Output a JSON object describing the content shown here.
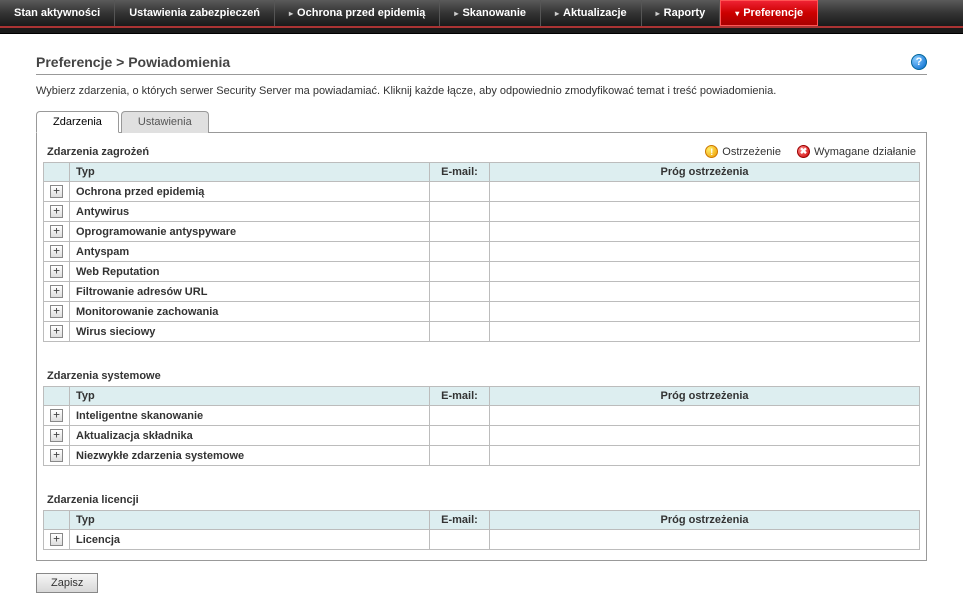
{
  "nav": {
    "items": [
      {
        "label": "Stan aktywności",
        "arrow": false
      },
      {
        "label": "Ustawienia zabezpieczeń",
        "arrow": false
      },
      {
        "label": "Ochrona przed epidemią",
        "arrow": true
      },
      {
        "label": "Skanowanie",
        "arrow": true
      },
      {
        "label": "Aktualizacje",
        "arrow": true
      },
      {
        "label": "Raporty",
        "arrow": true
      },
      {
        "label": "Preferencje",
        "arrow": true,
        "active": true
      }
    ]
  },
  "breadcrumb": "Preferencje > Powiadomienia",
  "help_tooltip": "?",
  "instruction": "Wybierz zdarzenia, o których serwer Security Server ma powiadamiać. Kliknij każde łącze, aby odpowiednio zmodyfikować temat i treść powiadomienia.",
  "tabs": [
    {
      "label": "Zdarzenia",
      "active": true
    },
    {
      "label": "Ustawienia",
      "active": false
    }
  ],
  "legend": {
    "warning": "Ostrzeżenie",
    "action_required": "Wymagane działanie"
  },
  "columns": {
    "type": "Typ",
    "email": "E-mail:",
    "threshold": "Próg ostrzeżenia"
  },
  "sections": [
    {
      "title": "Zdarzenia zagrożeń",
      "show_legend": true,
      "rows": [
        {
          "type": "Ochrona przed epidemią"
        },
        {
          "type": "Antywirus"
        },
        {
          "type": "Oprogramowanie antyspyware"
        },
        {
          "type": "Antyspam"
        },
        {
          "type": "Web Reputation"
        },
        {
          "type": "Filtrowanie adresów URL"
        },
        {
          "type": "Monitorowanie zachowania"
        },
        {
          "type": "Wirus sieciowy"
        }
      ]
    },
    {
      "title": "Zdarzenia systemowe",
      "show_legend": false,
      "rows": [
        {
          "type": "Inteligentne skanowanie"
        },
        {
          "type": "Aktualizacja składnika"
        },
        {
          "type": "Niezwykłe zdarzenia systemowe"
        }
      ]
    },
    {
      "title": "Zdarzenia licencji",
      "show_legend": false,
      "rows": [
        {
          "type": "Licencja"
        }
      ]
    }
  ],
  "save_button": "Zapisz",
  "icons": {
    "expand": "+"
  }
}
